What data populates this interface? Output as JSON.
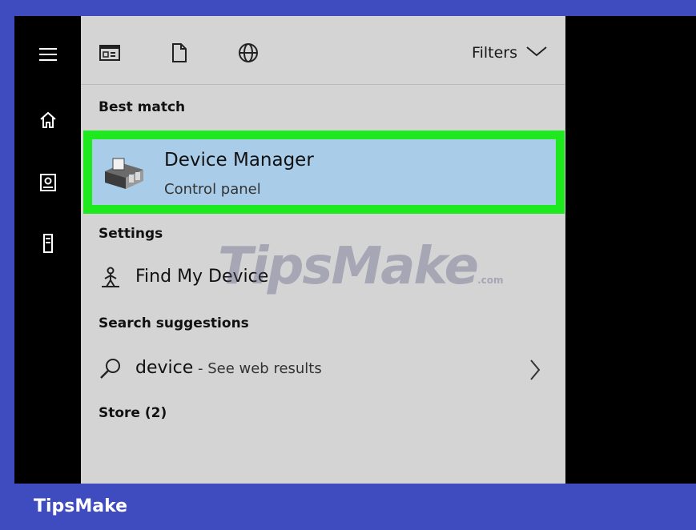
{
  "rail": {
    "items": [
      {
        "icon": "hamburger-menu-icon"
      },
      {
        "icon": "home-icon"
      },
      {
        "icon": "documents-icon"
      },
      {
        "icon": "tower-device-icon"
      }
    ]
  },
  "topbar": {
    "scopes": [
      {
        "icon": "apps-icon"
      },
      {
        "icon": "document-icon"
      },
      {
        "icon": "globe-icon"
      }
    ],
    "filters_label": "Filters"
  },
  "sections": {
    "best_match": "Best match",
    "settings": "Settings",
    "suggestions": "Search suggestions",
    "store": "Store (2)"
  },
  "best_match": {
    "title": "Device Manager",
    "subtitle": "Control panel",
    "icon": "device-manager-icon",
    "highlight_color": "#1ee81e",
    "selected_bg": "#a9cde9"
  },
  "settings_item": {
    "label": "Find My Device",
    "icon": "person-pin-icon"
  },
  "suggestion": {
    "query": "device",
    "suffix": " - See web results",
    "icon": "search-icon"
  },
  "watermark": {
    "main": "TipsMake",
    "suffix": ".com"
  },
  "brand": "TipsMake"
}
